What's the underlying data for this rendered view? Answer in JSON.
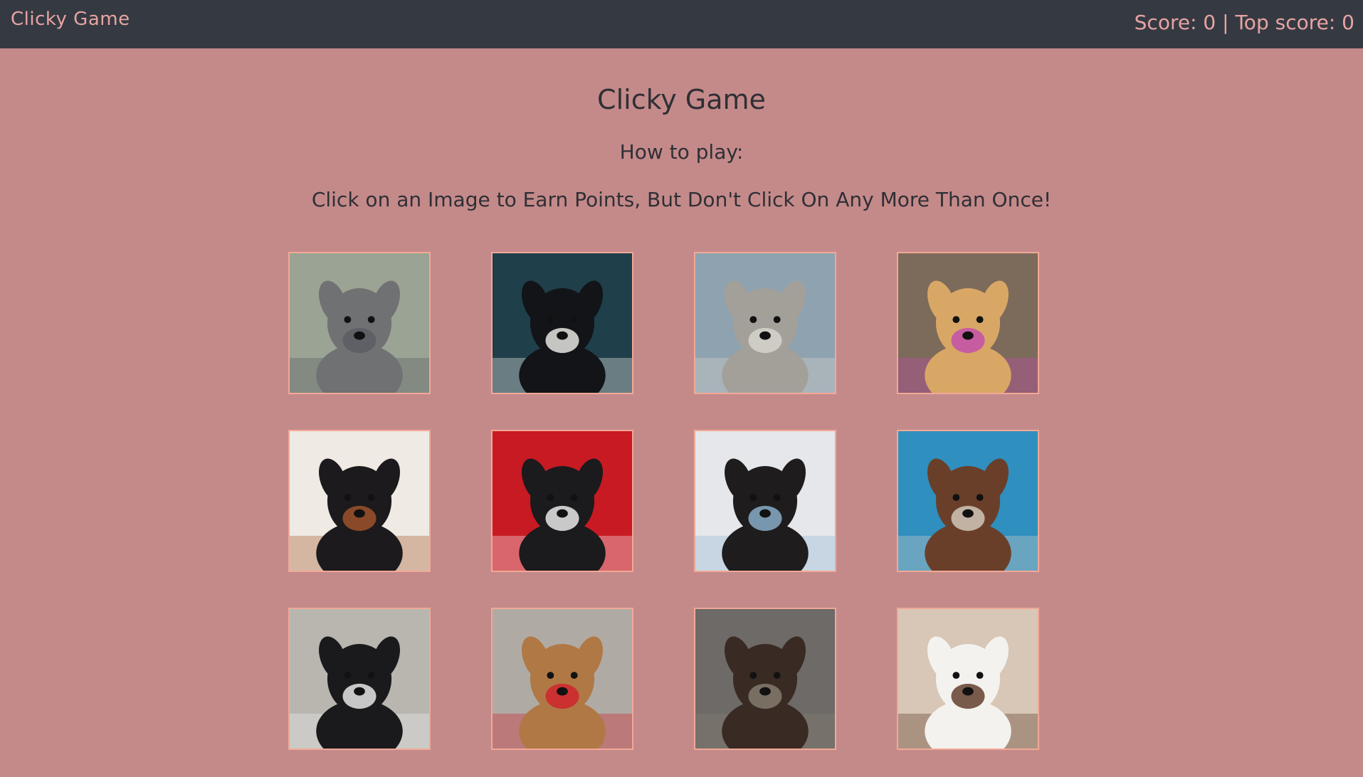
{
  "navbar": {
    "brand": "Clicky Game",
    "score_text": "Score: 0 | Top score: 0",
    "score": 0,
    "top_score": 0
  },
  "header": {
    "title": "Clicky Game",
    "subtitle": "How to play:",
    "instructions": "Click on an Image to Earn Points, But Don't Click On Any More Than Once!"
  },
  "colors": {
    "navbar_bg": "#353a42",
    "navbar_text": "#e8a3a3",
    "page_bg": "#c48a8a",
    "card_border": "#f2a896",
    "heading_text": "#2f2f35"
  },
  "cards": [
    {
      "name": "grey-great-dane-photo",
      "bg": "#9aa394",
      "fur": "#707173",
      "accent": "#5a5d61"
    },
    {
      "name": "border-collie-photo",
      "bg": "#1f3f4a",
      "fur": "#121418",
      "accent": "#f3f1ee"
    },
    {
      "name": "husky-on-mountain-photo",
      "bg": "#8fa2b0",
      "fur": "#a3a09a",
      "accent": "#d9d6cf"
    },
    {
      "name": "golden-retriever-flower-photo",
      "bg": "#7c6a5a",
      "fur": "#d9a765",
      "accent": "#c24bb0"
    },
    {
      "name": "pug-with-wooden-cabinet-photo",
      "bg": "#efeae4",
      "fur": "#1c1a1c",
      "accent": "#a6552c"
    },
    {
      "name": "pug-on-red-background-photo",
      "bg": "#c81a22",
      "fur": "#1b1a1d",
      "accent": "#f5f5f5"
    },
    {
      "name": "pug-in-denim-jacket-photo",
      "bg": "#e5e7ea",
      "fur": "#1e1c1d",
      "accent": "#8fb6d3"
    },
    {
      "name": "doberman-by-pool-photo",
      "bg": "#2f8fbf",
      "fur": "#6a3f2a",
      "accent": "#d7cfc2"
    },
    {
      "name": "husky-portrait-photo",
      "bg": "#b9b6b0",
      "fur": "#1a1a1c",
      "accent": "#f2f2f2"
    },
    {
      "name": "german-shepherd-red-scarf-photo",
      "bg": "#b0aaa4",
      "fur": "#b07845",
      "accent": "#d21f2a"
    },
    {
      "name": "brown-poodle-photo",
      "bg": "#6d6a67",
      "fur": "#3a2a24",
      "accent": "#8a7f72"
    },
    {
      "name": "pointer-on-bed-photo",
      "bg": "#d8c7b6",
      "fur": "#f4f2ef",
      "accent": "#5a3422"
    }
  ]
}
